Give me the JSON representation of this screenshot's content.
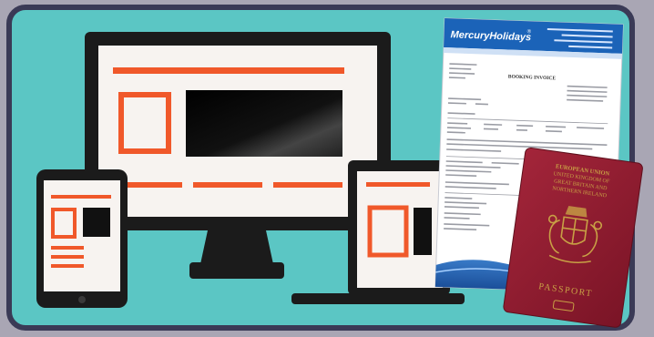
{
  "invoice": {
    "brand": "MercuryHolidays",
    "brand_mark": "®",
    "doc_title": "BOOKING INVOICE"
  },
  "passport": {
    "title": "PASSPORT",
    "header_lines": [
      "EUROPEAN UNION",
      "UNITED KINGDOM OF",
      "GREAT BRITAIN AND",
      "NORTHERN IRELAND"
    ]
  },
  "colors": {
    "frame": "#3a3a56",
    "background": "#5bc6c4",
    "wireframe_accent": "#f0582a",
    "device_body": "#1b1b1b",
    "invoice_blue": "#1b63b8",
    "passport": "#8e1c2e",
    "passport_gold": "#c8a045"
  }
}
